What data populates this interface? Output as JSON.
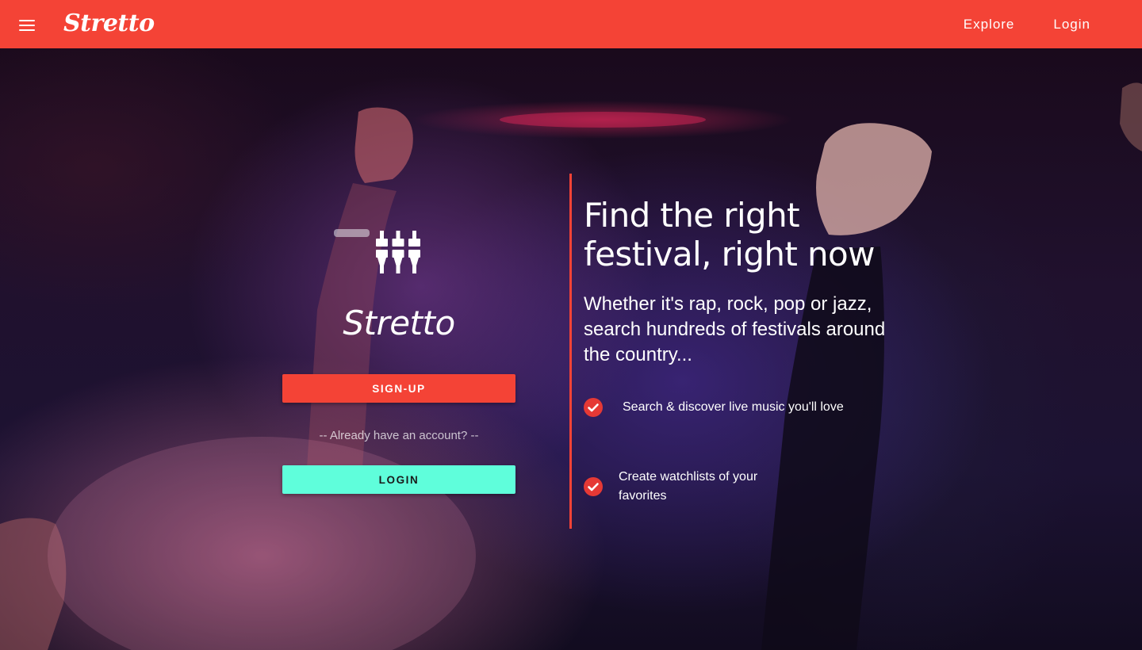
{
  "navbar": {
    "menu_icon": "hamburger-menu-icon",
    "brand": "Stretto",
    "links": [
      {
        "label": "Explore"
      },
      {
        "label": "Login"
      }
    ]
  },
  "hero": {
    "logo_icon": "sliders-equalizer-icon",
    "brand_name": "Stretto",
    "signup_label": "SIGN-UP",
    "already_text": "-- Already have an account? --",
    "login_label": "LOGIN",
    "headline": "Find the right festival, right now",
    "subhead": "Whether it's rap, rock, pop or jazz, search hundreds of festivals around the country...",
    "features": [
      {
        "icon": "check-circle-icon",
        "text": "Search & discover live music you'll love"
      },
      {
        "icon": "check-circle-icon",
        "text": "Create watchlists of your favorites"
      }
    ]
  },
  "colors": {
    "brand_red": "#f44336",
    "accent_teal": "#5ffedb",
    "text_white": "#ffffff"
  }
}
